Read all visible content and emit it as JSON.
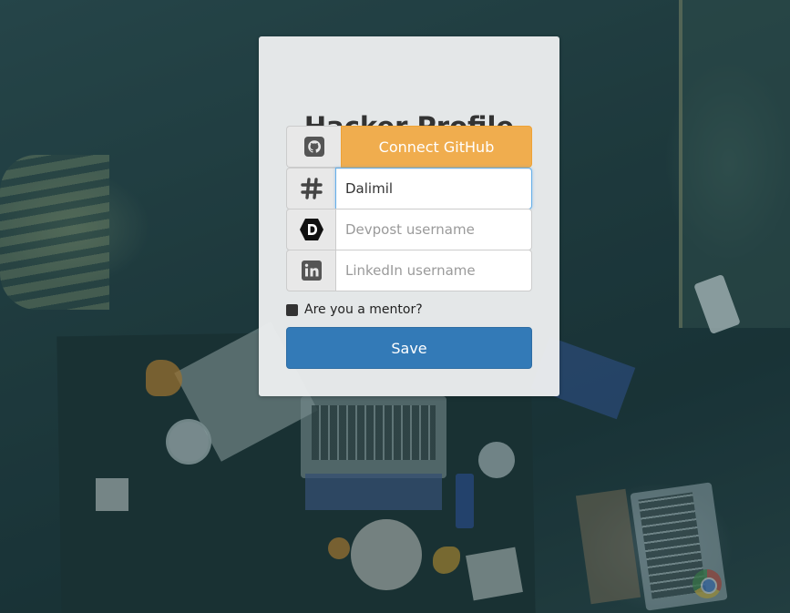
{
  "title": "Hacker Profile",
  "github": {
    "icon": "github-icon",
    "button_label": "Connect GitHub",
    "color": "#f0ad4e"
  },
  "slack": {
    "icon": "slack-hash-icon",
    "value": "Dalimil"
  },
  "devpost": {
    "icon": "devpost-icon",
    "placeholder": "Devpost username"
  },
  "linkedin": {
    "icon": "linkedin-icon",
    "placeholder": "LinkedIn username"
  },
  "mentor": {
    "label": "Are you a mentor?",
    "checked": false
  },
  "save": {
    "label": "Save",
    "color": "#337ab7"
  }
}
